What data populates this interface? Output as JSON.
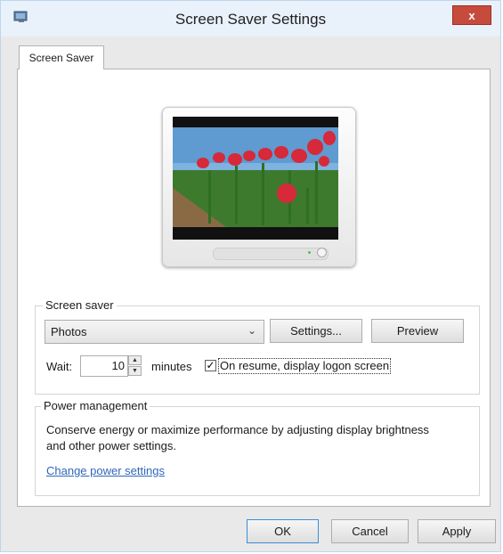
{
  "window": {
    "title": "Screen Saver Settings",
    "close_glyph": "x",
    "app_icon": "screen-saver-app-icon"
  },
  "tabs": [
    {
      "label": "Screen Saver",
      "selected": true
    }
  ],
  "preview": {
    "image_description": "icon-monitor-with-red-tulips-photo"
  },
  "screen_saver_group": {
    "legend": "Screen saver",
    "selected_option": "Photos",
    "settings_label": "Settings...",
    "preview_label": "Preview",
    "wait_label": "Wait:",
    "wait_value": "10",
    "minutes_label": "minutes",
    "logon_checked": true,
    "logon_label": "On resume, display logon screen"
  },
  "power_group": {
    "legend": "Power management",
    "description": "Conserve energy or maximize performance by adjusting display brightness and other power settings.",
    "link_label": "Change power settings"
  },
  "buttons": {
    "ok": "OK",
    "cancel": "Cancel",
    "apply": "Apply"
  },
  "colors": {
    "link": "#2e67b9",
    "close": "#c74b3c",
    "titlebar": "#e9f1fb"
  }
}
